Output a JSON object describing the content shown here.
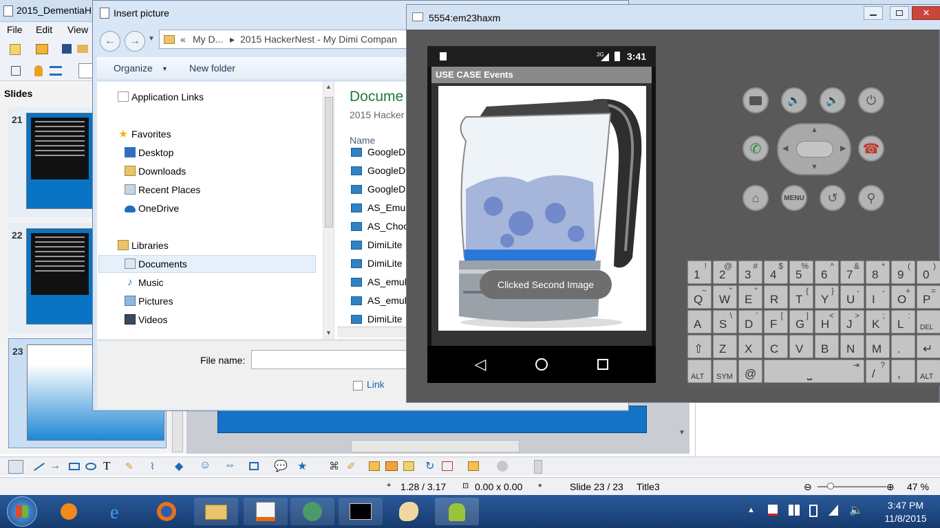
{
  "impress": {
    "title": "2015_DementiaH",
    "menu": [
      "File",
      "Edit",
      "View"
    ],
    "slides_header": "Slides",
    "slides": [
      {
        "number": "21"
      },
      {
        "number": "22"
      },
      {
        "number": "23"
      }
    ],
    "status": {
      "position": "1.28 / 3.17",
      "size": "0.00 x 0.00",
      "modified": "*",
      "slide": "Slide 23 / 23",
      "layout": "Title3",
      "zoom": "47 %"
    }
  },
  "dialog": {
    "title": "Insert picture",
    "address_parts": [
      "«",
      "My D...",
      "▸",
      "2015 HackerNest - My Dimi Compan"
    ],
    "organize_label": "Organize",
    "new_folder_label": "New folder",
    "nav_items": [
      {
        "label": "Application Links",
        "type": "links"
      },
      {
        "label": "Favorites",
        "type": "star"
      },
      {
        "label": "Desktop",
        "type": "desktop"
      },
      {
        "label": "Downloads",
        "type": "folder"
      },
      {
        "label": "Recent Places",
        "type": "recent"
      },
      {
        "label": "OneDrive",
        "type": "cloud"
      },
      {
        "label": "Libraries",
        "type": "libraries"
      },
      {
        "label": "Documents",
        "type": "docs",
        "selected": true
      },
      {
        "label": "Music",
        "type": "music"
      },
      {
        "label": "Pictures",
        "type": "pictures"
      },
      {
        "label": "Videos",
        "type": "videos"
      }
    ],
    "library_title": "Docume",
    "library_subtitle": "2015 Hacker",
    "column_name": "Name",
    "files": [
      "GoogleD",
      "GoogleD",
      "GoogleD",
      "AS_Emul",
      "AS_Choc",
      "DimiLite",
      "DimiLite",
      "AS_emul",
      "AS_emul",
      "DimiLite"
    ],
    "file_name_label": "File name:",
    "file_name_value": "",
    "link_label": "Link"
  },
  "emulator": {
    "title": "5554:em23haxm",
    "clock": "3:41",
    "network": "3G",
    "app_title": "USE CASE Events",
    "toast": "Clicked Second Image",
    "buttons": [
      "camera-icon",
      "volume-down-icon",
      "volume-up-icon",
      "power-icon",
      "call-icon",
      "end-call-icon",
      "home-icon",
      "menu-button",
      "back-icon",
      "search-icon"
    ],
    "menu_label": "MENU",
    "keyboard": {
      "row1": [
        {
          "k": "1",
          "s": "!"
        },
        {
          "k": "2",
          "s": "@"
        },
        {
          "k": "3",
          "s": "#"
        },
        {
          "k": "4",
          "s": "$"
        },
        {
          "k": "5",
          "s": "%"
        },
        {
          "k": "6",
          "s": "^"
        },
        {
          "k": "7",
          "s": "&"
        },
        {
          "k": "8",
          "s": "*"
        },
        {
          "k": "9",
          "s": "("
        },
        {
          "k": "0",
          "s": ")"
        }
      ],
      "row2": [
        {
          "k": "Q",
          "s": "~"
        },
        {
          "k": "W",
          "s": "\""
        },
        {
          "k": "E",
          "s": "\""
        },
        {
          "k": "R",
          "s": ""
        },
        {
          "k": "T",
          "s": "{"
        },
        {
          "k": "Y",
          "s": "}"
        },
        {
          "k": "U",
          "s": "-"
        },
        {
          "k": "I",
          "s": "-"
        },
        {
          "k": "O",
          "s": "+"
        },
        {
          "k": "P",
          "s": "="
        }
      ],
      "row3": [
        {
          "k": "A",
          "s": ""
        },
        {
          "k": "S",
          "s": "\\"
        },
        {
          "k": "D",
          "s": "'"
        },
        {
          "k": "F",
          "s": "["
        },
        {
          "k": "G",
          "s": "]"
        },
        {
          "k": "H",
          "s": "<"
        },
        {
          "k": "J",
          "s": ">"
        },
        {
          "k": "K",
          "s": ";"
        },
        {
          "k": "L",
          "s": ":"
        },
        {
          "k": "DEL",
          "s": ""
        }
      ],
      "row4": [
        {
          "k": "⇧",
          "s": ""
        },
        {
          "k": "Z",
          "s": ""
        },
        {
          "k": "X",
          "s": ""
        },
        {
          "k": "C",
          "s": ""
        },
        {
          "k": "V",
          "s": ""
        },
        {
          "k": "B",
          "s": ""
        },
        {
          "k": "N",
          "s": ""
        },
        {
          "k": "M",
          "s": ""
        },
        {
          "k": ".",
          "s": ""
        },
        {
          "k": "↵",
          "s": ""
        }
      ],
      "row5": [
        {
          "k": "ALT",
          "s": ""
        },
        {
          "k": "SYM",
          "s": ""
        },
        {
          "k": "@",
          "s": ""
        },
        {
          "k": "⎵",
          "s": "⇥"
        },
        {
          "k": "/",
          "s": "?"
        },
        {
          "k": ",",
          "s": ""
        },
        {
          "k": "ALT",
          "s": ""
        }
      ]
    }
  },
  "taskbar": {
    "time": "3:47 PM",
    "date": "11/8/2015",
    "apps": [
      "internet-explorer",
      "firefox",
      "file-explorer",
      "impress",
      "android-studio",
      "command-prompt",
      "paint",
      "android-emulator"
    ]
  },
  "colors": {
    "accent_blue": "#1573c7",
    "emulator_body": "#595959",
    "library_title_green": "#1e7a3a"
  }
}
